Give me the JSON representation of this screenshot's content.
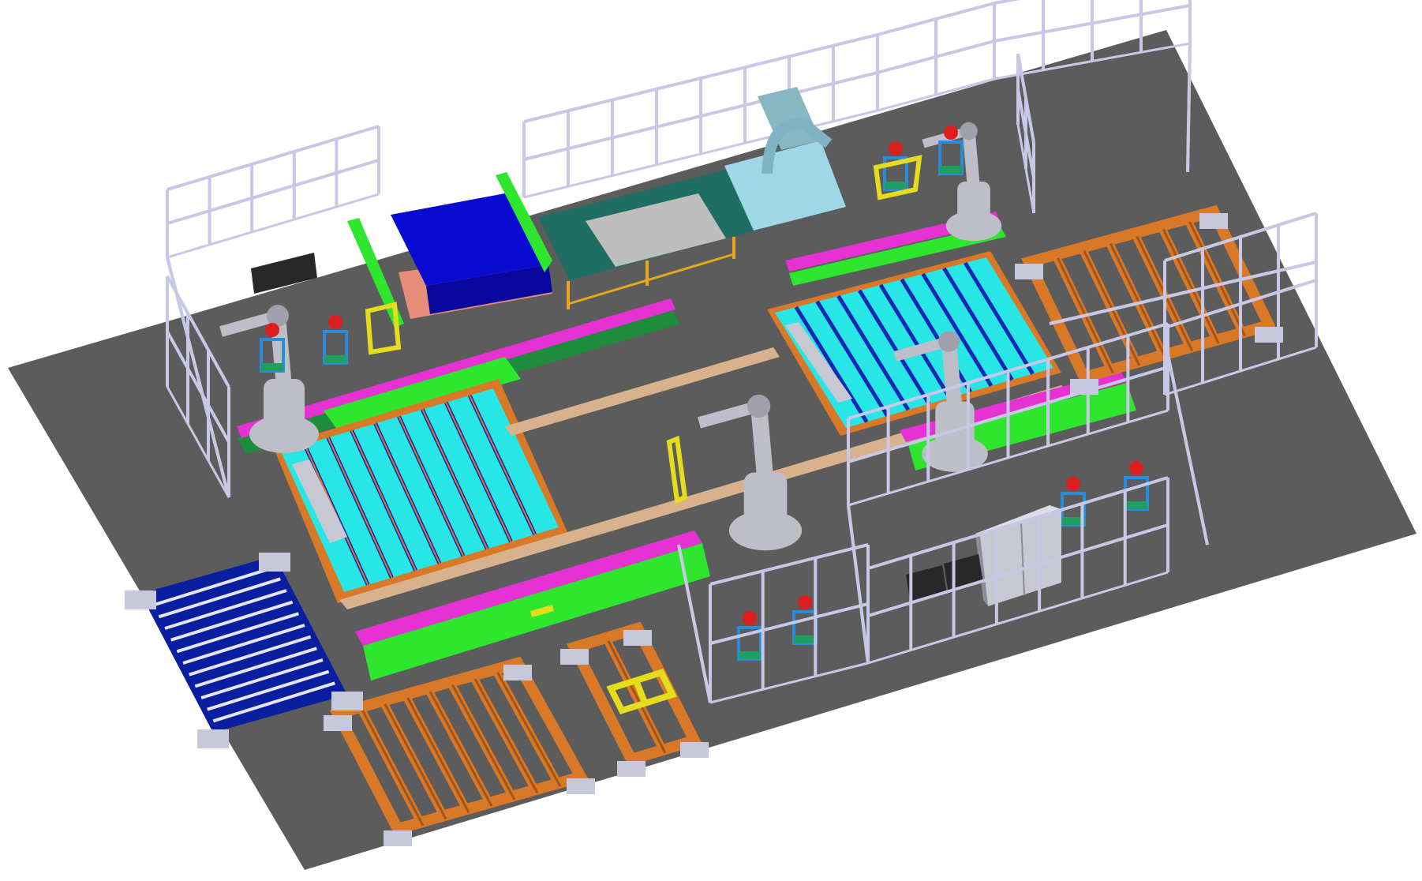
{
  "scene": {
    "colors": {
      "background": "#ffffff",
      "floor": "#5c5c5c",
      "fence": "#c8c8e6",
      "fence_dark": "#9696b4",
      "orange_frame": "#d97826",
      "orange_dark": "#a0561a",
      "blue_pallet": "#0a1ea0",
      "pallet_slat": "#e6e6f0",
      "conveyor_green": "#2ee62e",
      "conveyor_magenta": "#e632d2",
      "conveyor_dark": "#1e8c3c",
      "cyan_panel": "#28e6e6",
      "panel_bar": "#1428b4",
      "rail_tan": "#d7b28c",
      "robot_gray": "#bebec8",
      "blue_block": "#0a0ad2",
      "teal_table": "#1e6e64",
      "light_panel": "#bebebe",
      "ice_blue": "#a0d7e6",
      "yellow": "#e6dc1e",
      "cabinet": "#c8c8d2",
      "cabinet_dark": "#8c8c9b",
      "tool_red": "#dc1e1e",
      "stand_blue": "#2a8cdc",
      "stand_green": "#1ea064",
      "base_gray": "#c8c8dc",
      "black_box": "#282828",
      "salmon": "#e68c78"
    }
  }
}
